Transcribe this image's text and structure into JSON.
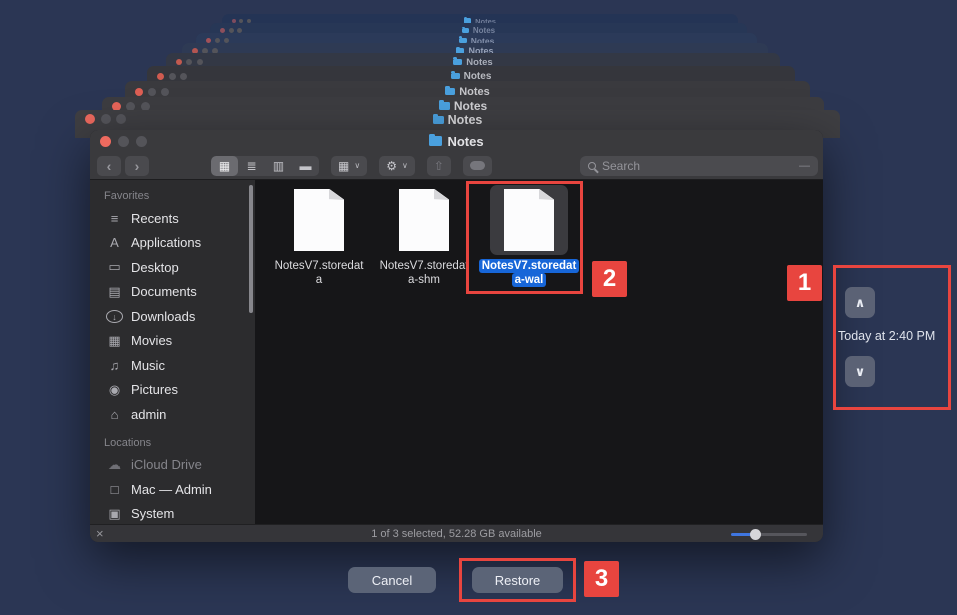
{
  "stack": {
    "title": "Notes"
  },
  "window": {
    "title": "Notes",
    "toolbar": {
      "back": "‹",
      "forward": "›",
      "view_grid": "▦",
      "view_list": "≣",
      "view_columns": "▥",
      "view_gallery": "▬",
      "group_icon": "▦",
      "gear_icon": "⚙",
      "share_icon": "⇧",
      "chevron_down": "∨",
      "search_placeholder": "Search",
      "resize_dash": "—"
    },
    "sidebar": {
      "favorites_label": "Favorites",
      "favorites": [
        {
          "label": "Recents",
          "icon": "≡"
        },
        {
          "label": "Applications",
          "icon": "A"
        },
        {
          "label": "Desktop",
          "icon": "▭"
        },
        {
          "label": "Documents",
          "icon": "▤"
        },
        {
          "label": "Downloads",
          "icon": "↓"
        },
        {
          "label": "Movies",
          "icon": "▦"
        },
        {
          "label": "Music",
          "icon": "♫"
        },
        {
          "label": "Pictures",
          "icon": "◉"
        },
        {
          "label": "admin",
          "icon": "⌂"
        }
      ],
      "locations_label": "Locations",
      "locations": [
        {
          "label": "iCloud Drive",
          "icon": "☁"
        },
        {
          "label": "Mac — Admin",
          "icon": "□"
        },
        {
          "label": "System",
          "icon": "▣"
        }
      ]
    },
    "files": [
      {
        "lines": [
          "NotesV7.storedat",
          "a"
        ],
        "selected": false
      },
      {
        "lines": [
          "NotesV7.storedat",
          "a-shm"
        ],
        "selected": false
      },
      {
        "lines": [
          "NotesV7.storedat",
          "a-wal"
        ],
        "selected": true
      }
    ],
    "statusbar": {
      "close_icon": "×",
      "text": "1 of 3 selected, 52.28 GB available",
      "icon_size_slider_percent": 30
    }
  },
  "timemachine": {
    "up_icon": "∧",
    "down_icon": "∨",
    "timestamp": "Today at 2:40 PM",
    "cancel_label": "Cancel",
    "restore_label": "Restore"
  },
  "annotations": {
    "step1": "1",
    "step2": "2",
    "step3": "3"
  },
  "colors": {
    "annotation_red": "#e8453f",
    "selection_blue": "#1766d8",
    "folder_blue": "#4aa0de",
    "traffic_red": "#ee6a5f",
    "background_navy": "#252c47",
    "chrome_gray": "#3a3a3d"
  }
}
